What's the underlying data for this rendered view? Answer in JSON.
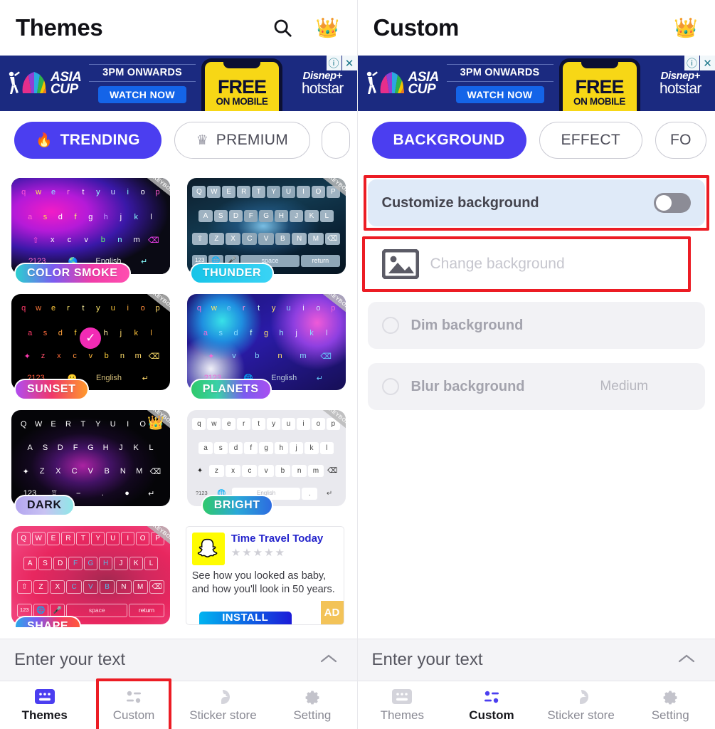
{
  "panels": {
    "left": {
      "header": {
        "title": "Themes",
        "search_icon": "search-icon",
        "crown_icon": "👑"
      },
      "tabs": [
        {
          "label": "TRENDING",
          "icon": "🔥",
          "active": true
        },
        {
          "label": "PREMIUM",
          "icon": "♛",
          "active": false
        },
        {
          "label": "",
          "icon": "",
          "active": false
        }
      ],
      "themes": [
        {
          "name": "COLOR SMOKE",
          "ribbon": "NEON LED KEYBOARD",
          "premium": false
        },
        {
          "name": "THUNDER",
          "ribbon": "NEON LED KEYBOARD",
          "premium": false
        },
        {
          "name": "SUNSET",
          "ribbon": "NEON LED KEYBOARD",
          "premium": false
        },
        {
          "name": "PLANETS",
          "ribbon": "NEON LED KEYBOARD",
          "premium": false
        },
        {
          "name": "DARK",
          "ribbon": "NEON LED KEYBOARD",
          "premium": true
        },
        {
          "name": "BRIGHT",
          "ribbon": "NEON LED KEYBOARD",
          "premium": false
        },
        {
          "name": "SHAPE",
          "ribbon": "NEON LED KEYBOARD",
          "premium": false
        }
      ],
      "grid_ad": {
        "title": "Time Travel Today",
        "stars": "★★★★★",
        "body": "See how you looked as baby, and how you'll look in 50 years.",
        "install_label": "INSTALL",
        "ad_tag": "AD"
      }
    },
    "right": {
      "header": {
        "title": "Custom",
        "crown_icon": "👑"
      },
      "tabs": [
        {
          "label": "BACKGROUND",
          "active": true
        },
        {
          "label": "EFFECT",
          "active": false
        },
        {
          "label": "FO",
          "active": false
        }
      ],
      "settings": {
        "customize_background": {
          "label": "Customize background",
          "toggle_on": false,
          "highlighted": true
        },
        "change_background": {
          "label": "Change background",
          "icon": "image-icon",
          "highlighted": true
        },
        "dim_background": {
          "label": "Dim background",
          "selected": false
        },
        "blur_background": {
          "label": "Blur background",
          "value": "Medium",
          "selected": false
        }
      }
    }
  },
  "ad_banner": {
    "brand": "ASIA CUP",
    "brand_line1": "ASIA",
    "brand_line2": "CUP",
    "time_text_bold": "3PM",
    "time_text_rest": " ONWARDS",
    "cta": "WATCH NOW",
    "phone_free": "FREE",
    "phone_sub": "ON MOBILE",
    "provider_top": "Disnep+",
    "provider_bottom": "hotstar",
    "info_icon": "ⓘ",
    "close_icon": "✕"
  },
  "input_bar": {
    "label": "Enter your text",
    "chevron": "chevron-up-icon"
  },
  "bottom_nav": {
    "items": [
      {
        "label": "Themes",
        "icon": "keyboard-icon"
      },
      {
        "label": "Custom",
        "icon": "sliders-icon"
      },
      {
        "label": "Sticker store",
        "icon": "sticker-icon"
      },
      {
        "label": "Setting",
        "icon": "gear-icon"
      }
    ],
    "left_active_index": 0,
    "right_active_index": 1,
    "left_highlight_index": 1
  },
  "colors": {
    "accent": "#4b3ef0",
    "highlight_red": "#ec1c24",
    "row_highlight_blue": "#dfeaf8",
    "row_gray": "#f2f2f5",
    "ad_navy": "#1b2a80",
    "ad_yellow": "#f7d716"
  }
}
